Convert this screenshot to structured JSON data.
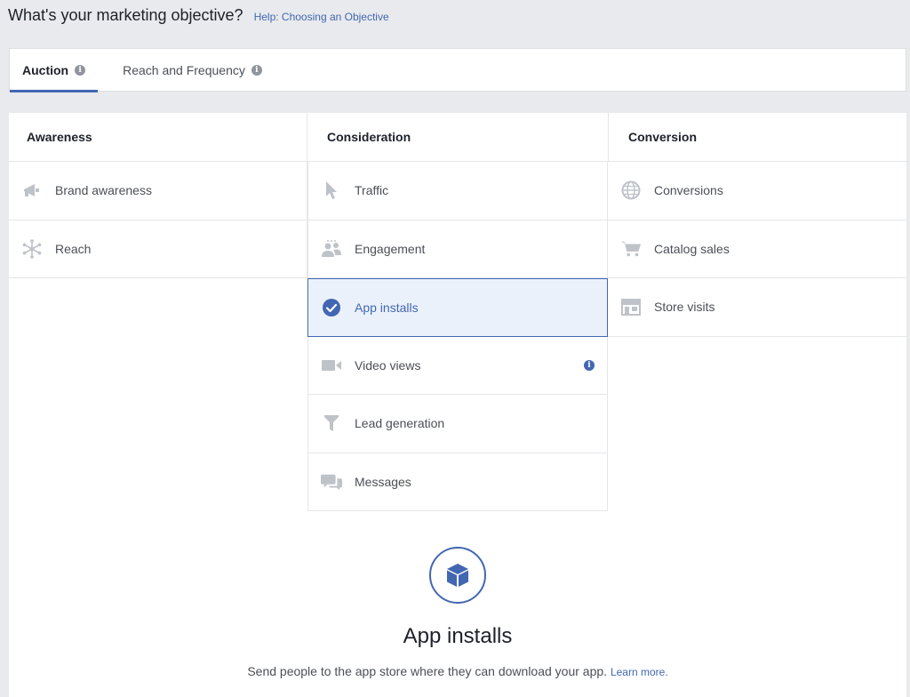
{
  "header": {
    "title": "What's your marketing objective?",
    "help_link": "Help: Choosing an Objective"
  },
  "tabs": [
    {
      "label": "Auction",
      "active": true,
      "info": "i"
    },
    {
      "label": "Reach and Frequency",
      "active": false,
      "info": "i"
    }
  ],
  "columns": [
    {
      "title": "Awareness",
      "items": [
        {
          "label": "Brand awareness",
          "icon": "megaphone-icon"
        },
        {
          "label": "Reach",
          "icon": "reach-icon"
        }
      ]
    },
    {
      "title": "Consideration",
      "items": [
        {
          "label": "Traffic",
          "icon": "cursor-icon"
        },
        {
          "label": "Engagement",
          "icon": "people-icon"
        },
        {
          "label": "App installs",
          "icon": "check-circle-icon",
          "selected": true
        },
        {
          "label": "Video views",
          "icon": "video-camera-icon",
          "info": "i"
        },
        {
          "label": "Lead generation",
          "icon": "funnel-icon"
        },
        {
          "label": "Messages",
          "icon": "chat-bubbles-icon"
        }
      ]
    },
    {
      "title": "Conversion",
      "items": [
        {
          "label": "Conversions",
          "icon": "globe-icon"
        },
        {
          "label": "Catalog sales",
          "icon": "cart-icon"
        },
        {
          "label": "Store visits",
          "icon": "store-icon"
        }
      ]
    }
  ],
  "detail": {
    "icon": "cube-icon",
    "title": "App installs",
    "description": "Send people to the app store where they can download your app.",
    "learn_more": "Learn more."
  },
  "colors": {
    "accent": "#4267b2",
    "icon_gray": "#bec3c9",
    "selected_bg": "#ebf1fb",
    "page_bg": "#e9eaed"
  }
}
